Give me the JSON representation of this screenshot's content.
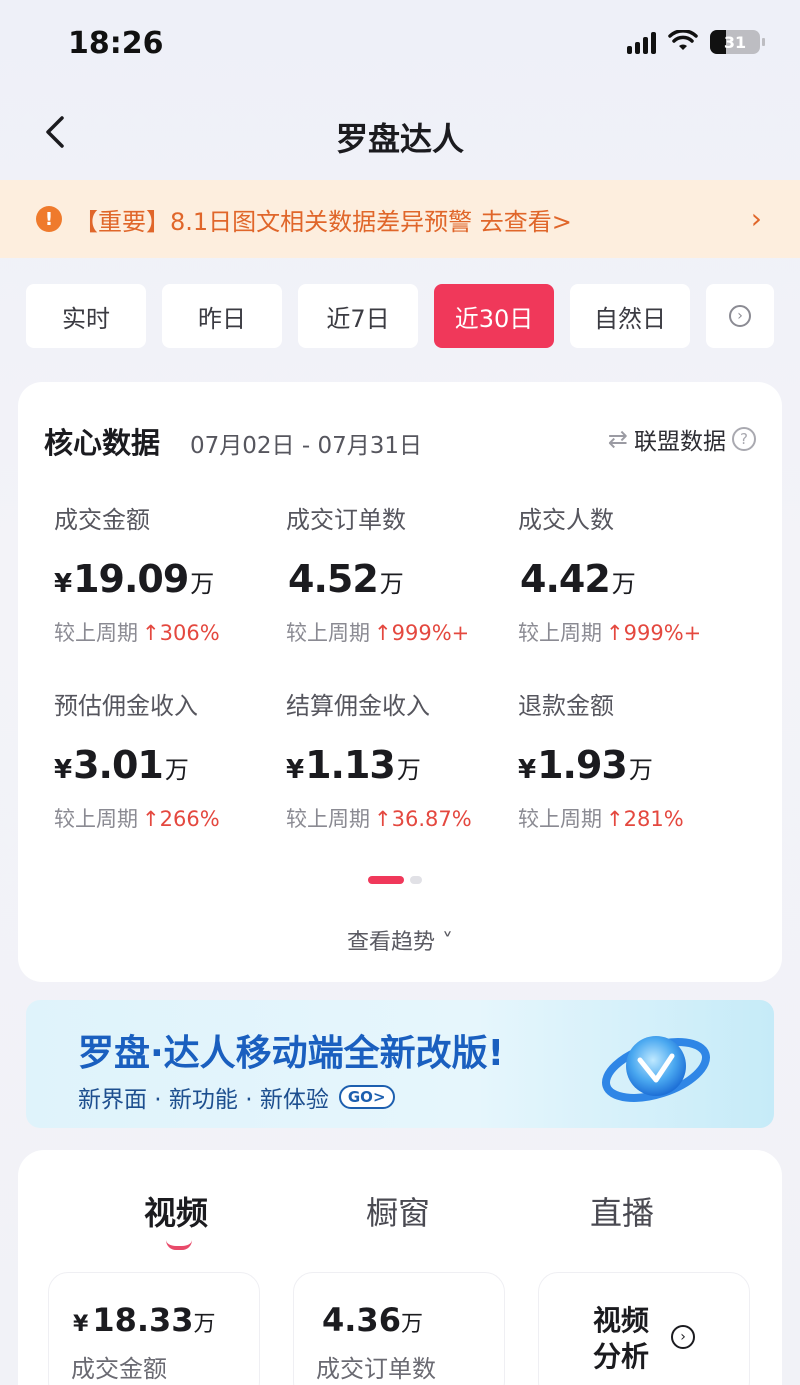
{
  "status_bar": {
    "time": "18:26",
    "battery": "31"
  },
  "nav": {
    "title": "罗盘达人"
  },
  "notice": {
    "text": "【重要】8.1日图文相关数据差异预警 去查看>",
    "arrow": "›"
  },
  "time_tabs": [
    {
      "label": "实时",
      "active": false
    },
    {
      "label": "昨日",
      "active": false
    },
    {
      "label": "近7日",
      "active": false
    },
    {
      "label": "近30日",
      "active": true
    },
    {
      "label": "自然日",
      "active": false
    }
  ],
  "core": {
    "title": "核心数据",
    "range": "07月02日 - 07月31日",
    "alliance_label": "联盟数据",
    "metrics": [
      {
        "label": "成交金额",
        "currency": "¥",
        "value": "19.09",
        "unit": "万",
        "compare_label": "较上周期",
        "change": "306%"
      },
      {
        "label": "成交订单数",
        "currency": "",
        "value": "4.52",
        "unit": "万",
        "compare_label": "较上周期",
        "change": "999%+"
      },
      {
        "label": "成交人数",
        "currency": "",
        "value": "4.42",
        "unit": "万",
        "compare_label": "较上周期",
        "change": "999%+"
      },
      {
        "label": "预估佣金收入",
        "currency": "¥",
        "value": "3.01",
        "unit": "万",
        "compare_label": "较上周期",
        "change": "266%"
      },
      {
        "label": "结算佣金收入",
        "currency": "¥",
        "value": "1.13",
        "unit": "万",
        "compare_label": "较上周期",
        "change": "36.87%"
      },
      {
        "label": "退款金额",
        "currency": "¥",
        "value": "1.93",
        "unit": "万",
        "compare_label": "较上周期",
        "change": "281%"
      }
    ],
    "trend_label": "查看趋势 ˅"
  },
  "banner": {
    "title": "罗盘·达人移动端全新改版!",
    "subtitle": "新界面 · 新功能 · 新体验",
    "go": "GO>"
  },
  "content_tabs": [
    {
      "label": "视频",
      "active": true
    },
    {
      "label": "橱窗",
      "active": false
    },
    {
      "label": "直播",
      "active": false
    }
  ],
  "video_stats": [
    {
      "currency": "¥",
      "value": "18.33",
      "unit": "万",
      "label": "成交金额"
    },
    {
      "currency": "",
      "value": "4.36",
      "unit": "万",
      "label": "成交订单数"
    }
  ],
  "video_analysis": {
    "label": "视频分析"
  },
  "colors": {
    "accent": "#f0385a",
    "notice": "#e0662a",
    "up": "#e4483f"
  }
}
